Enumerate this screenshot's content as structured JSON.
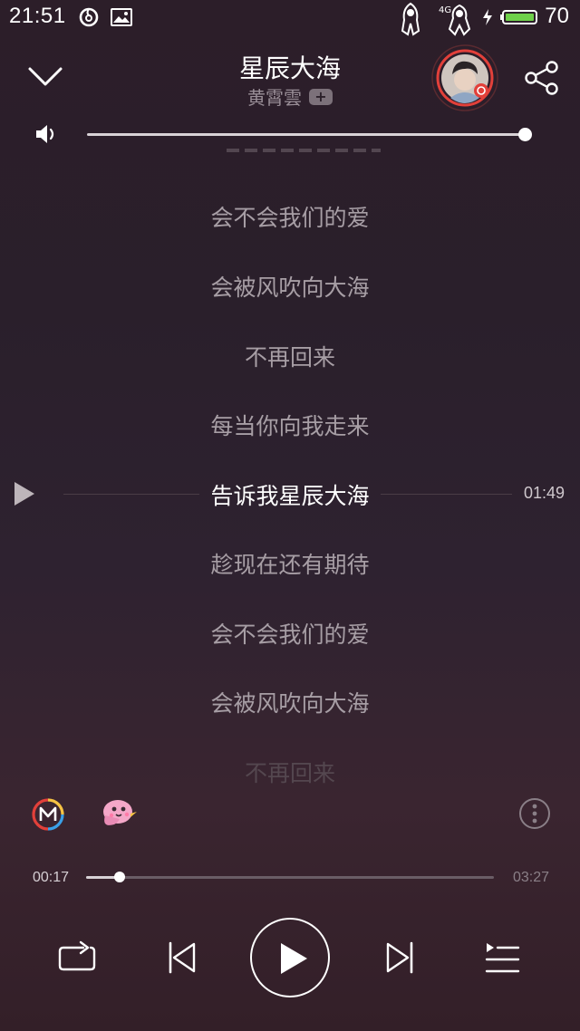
{
  "status_bar": {
    "time": "21:51",
    "network": "4G",
    "battery_level": 70,
    "battery_text": "70"
  },
  "header": {
    "song_title": "星辰大海",
    "artist": "黄霄雲",
    "add_label": "+",
    "icons": [
      "collapse-chevron-icon",
      "avatar",
      "share-icon"
    ]
  },
  "volume": {
    "level": 1.0,
    "icon": "speaker-icon"
  },
  "lyrics": {
    "lines": [
      "会不会我们的爱",
      "会被风吹向大海",
      "不再回来",
      "每当你向我走来",
      "告诉我星辰大海",
      "趁现在还有期待",
      "会不会我们的爱",
      "会被风吹向大海",
      "不再回来"
    ],
    "current_index": 4,
    "scrub_time": "01:49"
  },
  "tools": {
    "icons": [
      "m-logo-icon",
      "pink-bird-icon",
      "more-dots-icon"
    ]
  },
  "progress": {
    "elapsed": "00:17",
    "total": "03:27",
    "fraction": 0.082
  },
  "controls": {
    "icons": [
      "repeat-icon",
      "previous-icon",
      "play-icon",
      "next-icon",
      "playlist-icon"
    ]
  },
  "colors": {
    "accent_red": "#e2403a",
    "lyric_dim": "#a79ea5",
    "lyric_current": "#ffffff"
  }
}
